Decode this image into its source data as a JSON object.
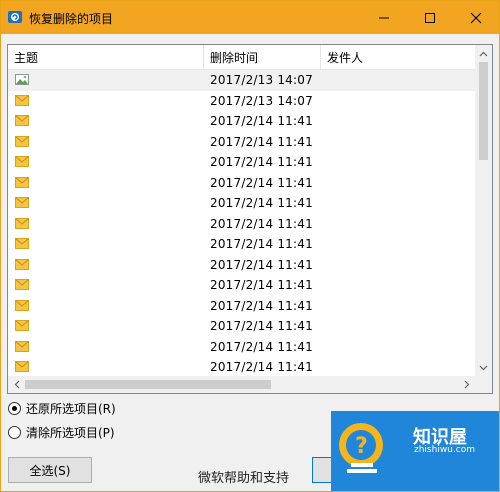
{
  "window": {
    "title": "恢复删除的项目"
  },
  "list": {
    "columns": [
      "主题",
      "删除时间",
      "发件人"
    ],
    "rows": [
      {
        "type": "image-mail",
        "date": "2017/2/13 14:07"
      },
      {
        "type": "mail",
        "date": "2017/2/13 14:07"
      },
      {
        "type": "mail",
        "date": "2017/2/14 11:41"
      },
      {
        "type": "mail",
        "date": "2017/2/14 11:41"
      },
      {
        "type": "mail",
        "date": "2017/2/14 11:41"
      },
      {
        "type": "mail",
        "date": "2017/2/14 11:41"
      },
      {
        "type": "mail",
        "date": "2017/2/14 11:41"
      },
      {
        "type": "mail",
        "date": "2017/2/14 11:41"
      },
      {
        "type": "mail",
        "date": "2017/2/14 11:41"
      },
      {
        "type": "mail",
        "date": "2017/2/14 11:41"
      },
      {
        "type": "mail",
        "date": "2017/2/14 11:41"
      },
      {
        "type": "mail",
        "date": "2017/2/14 11:41"
      },
      {
        "type": "mail",
        "date": "2017/2/14 11:41"
      },
      {
        "type": "mail",
        "date": "2017/2/14 11:41"
      },
      {
        "type": "mail",
        "date": "2017/2/14 11:41"
      }
    ]
  },
  "options": {
    "restore_label": "还原所选项目(R)",
    "purge_label": "清除所选项目(P)",
    "selected": "restore"
  },
  "buttons": {
    "select_all": "全选(S)"
  },
  "footer": {
    "help_text": "微软帮助和支持"
  },
  "watermark": {
    "brand": "知识屋",
    "url": "zhishiwu.com"
  },
  "colors": {
    "titlebar": "#f2a521",
    "mail_icon": "#f5c542",
    "accent": "#0078d7"
  }
}
